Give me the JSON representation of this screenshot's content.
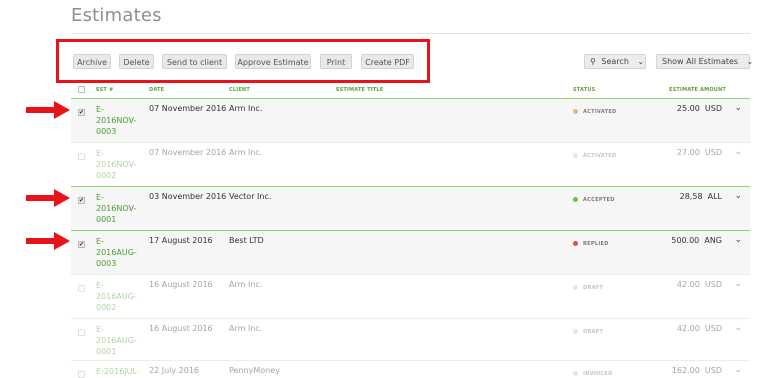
{
  "page": {
    "title": "Estimates"
  },
  "toolbar": {
    "archive": "Archive",
    "delete": "Delete",
    "send": "Send to client",
    "approve": "Approve Estimate",
    "print": "Print",
    "pdf": "Create PDF"
  },
  "search": {
    "label": "Search"
  },
  "filter": {
    "label": "Show All Estimates"
  },
  "columns": {
    "est": "EST #",
    "date": "DATE",
    "client": "CLIENT",
    "title": "ESTIMATE TITLE",
    "status": "STATUS",
    "amount": "ESTIMATE AMOUNT"
  },
  "rows": [
    {
      "est": "E-\n2016NOV-\n0003",
      "date": "07 November 2016",
      "client": "Arm Inc.",
      "status": "ACTIVATED",
      "amount": "25.00  USD",
      "checked": true,
      "dot": "#f0b27a"
    },
    {
      "est": "E-\n2016NOV-\n0002",
      "date": "07 November 2016",
      "client": "Arm Inc.",
      "status": "ACTIVATED",
      "amount": "27.00  USD",
      "checked": false,
      "dot": "#c9c9c9"
    },
    {
      "est": "E-\n2016NOV-\n0001",
      "date": "03 November 2016",
      "client": "Vector Inc.",
      "status": "ACCEPTED",
      "amount": "28,58  ALL",
      "checked": true,
      "dot": "#6cc04a"
    },
    {
      "est": "E-\n2016AUG-\n0003",
      "date": "17 August 2016",
      "client": "Best LTD",
      "status": "REPLIED",
      "amount": "500.00  ANG",
      "checked": true,
      "dot": "#e94b4b"
    },
    {
      "est": "E-\n2016AUG-\n0002",
      "date": "16 August 2016",
      "client": "Arm Inc.",
      "status": "DRAFT",
      "amount": "42.00  USD",
      "checked": false,
      "dot": "#c9c9c9"
    },
    {
      "est": "E-\n2016AUG-\n0001",
      "date": "16 August 2016",
      "client": "Arm Inc.",
      "status": "DRAFT",
      "amount": "42.00  USD",
      "checked": false,
      "dot": "#c9c9c9"
    },
    {
      "est": "E-2016JUL-",
      "date": "22 July 2016",
      "client": "PennyMoney",
      "status": "INVOICED",
      "amount": "162.00  USD",
      "checked": false,
      "dot": "#c9c9c9"
    }
  ],
  "colors": {
    "accent_green": "#4a9f2f",
    "highlight_red": "#e8121b"
  }
}
